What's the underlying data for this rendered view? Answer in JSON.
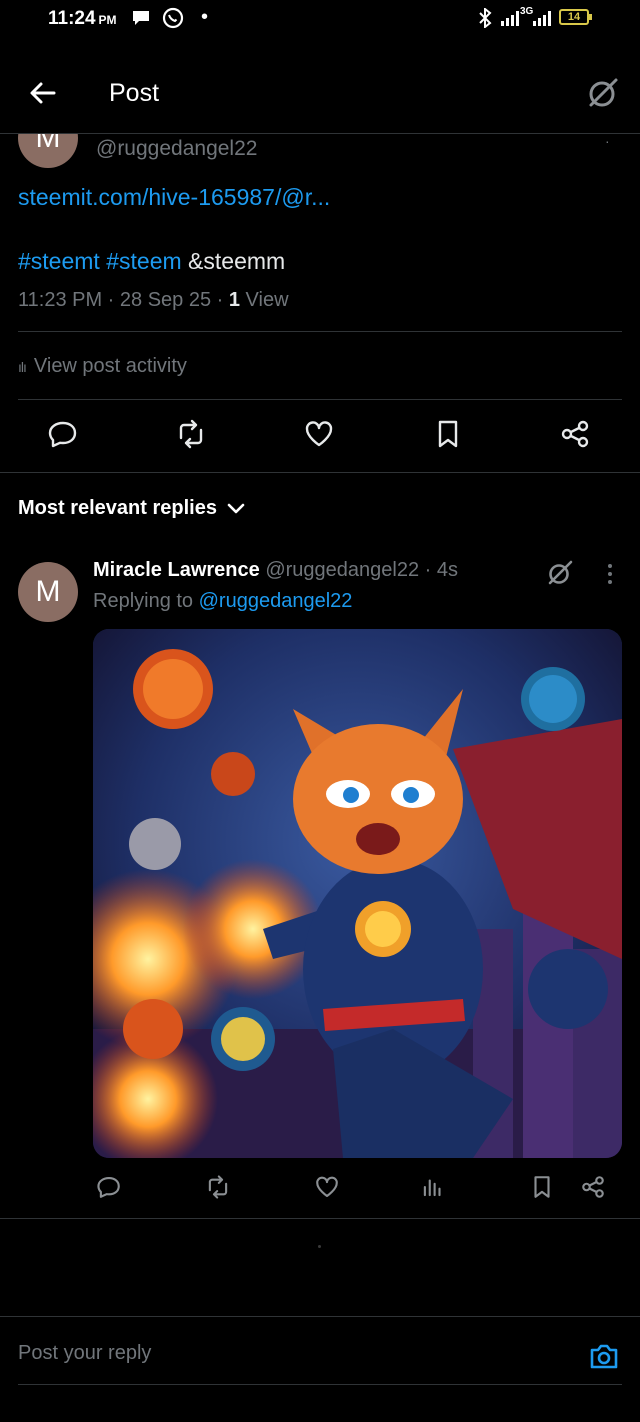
{
  "status_bar": {
    "time": "11:24",
    "ampm": "PM",
    "battery": "14",
    "network": "3G"
  },
  "header": {
    "title": "Post"
  },
  "post": {
    "avatar_letter": "M",
    "handle": "@ruggedangel22",
    "link": "steemit.com/hive-165987/@r...",
    "tag1": "#steemt",
    "tag2": "#steem",
    "tag3": "&steemm",
    "timestamp": "11:23 PM · 28 Sep 25 · ",
    "views_count": "1",
    "views_label": " View",
    "activity_label": "View post activity"
  },
  "replies": {
    "sort_label": "Most relevant replies",
    "items": [
      {
        "avatar_letter": "M",
        "name": "Miracle Lawrence",
        "handle": "@ruggedangel22",
        "age": "· 4s",
        "replying_prefix": "Replying to ",
        "replying_handle": "@ruggedangel22"
      }
    ]
  },
  "composer": {
    "placeholder": "Post your reply"
  },
  "colors": {
    "accent": "#1d9bf0",
    "muted": "#71767b",
    "divider": "#2f3336",
    "background": "#000000"
  },
  "icons": [
    "back-arrow-icon",
    "grok-icon",
    "reply-icon",
    "repost-icon",
    "like-icon",
    "bookmark-icon",
    "share-icon",
    "analytics-icon",
    "chevron-down-icon",
    "more-icon",
    "camera-icon"
  ]
}
